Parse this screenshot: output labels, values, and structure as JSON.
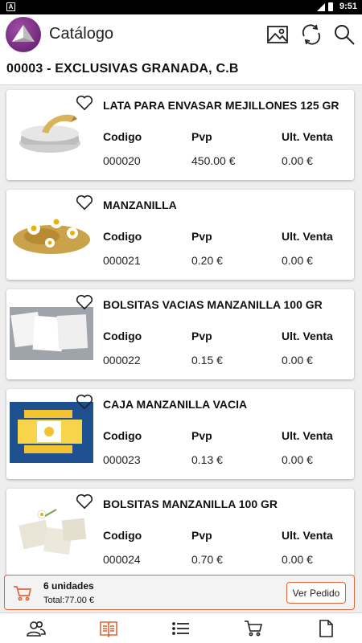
{
  "status_bar": {
    "time": "9:51",
    "notification_icon": "A"
  },
  "app_bar": {
    "title": "Catálogo",
    "icons": [
      "image-icon",
      "refresh-icon",
      "search-icon"
    ]
  },
  "client": {
    "name": "00003 - EXCLUSIVAS GRANADA, C.B"
  },
  "colors": {
    "accent": "#e0663a",
    "logo_purple": "#7a2d86"
  },
  "products": [
    {
      "name": "LATA PARA ENVASAR MEJILLONES 125 GR",
      "code_label": "Codigo",
      "pvp_label": "Pvp",
      "last_label": "Ult. Venta",
      "code": "000020",
      "pvp": "450.00 €",
      "last": "0.00 €"
    },
    {
      "name": "MANZANILLA",
      "code_label": "Codigo",
      "pvp_label": "Pvp",
      "last_label": "Ult. Venta",
      "code": "000021",
      "pvp": "0.20 €",
      "last": "0.00 €"
    },
    {
      "name": "BOLSITAS VACIAS MANZANILLA 100 GR",
      "code_label": "Codigo",
      "pvp_label": "Pvp",
      "last_label": "Ult. Venta",
      "code": "000022",
      "pvp": "0.15 €",
      "last": "0.00 €"
    },
    {
      "name": "CAJA MANZANILLA VACIA",
      "code_label": "Codigo",
      "pvp_label": "Pvp",
      "last_label": "Ult. Venta",
      "code": "000023",
      "pvp": "0.13 €",
      "last": "0.00 €"
    },
    {
      "name": "BOLSITAS MANZANILLA 100 GR",
      "code_label": "Codigo",
      "pvp_label": "Pvp",
      "last_label": "Ult. Venta",
      "code": "000024",
      "pvp": "0.70 €",
      "last": "0.00 €"
    }
  ],
  "cart": {
    "units": "6 unidades",
    "total": "Total:77.00 €",
    "button": "Ver Pedido"
  },
  "bottom_nav": {
    "items": [
      "clients-icon",
      "catalog-icon",
      "list-icon",
      "cart-icon",
      "document-icon"
    ],
    "active": "catalog-icon"
  }
}
